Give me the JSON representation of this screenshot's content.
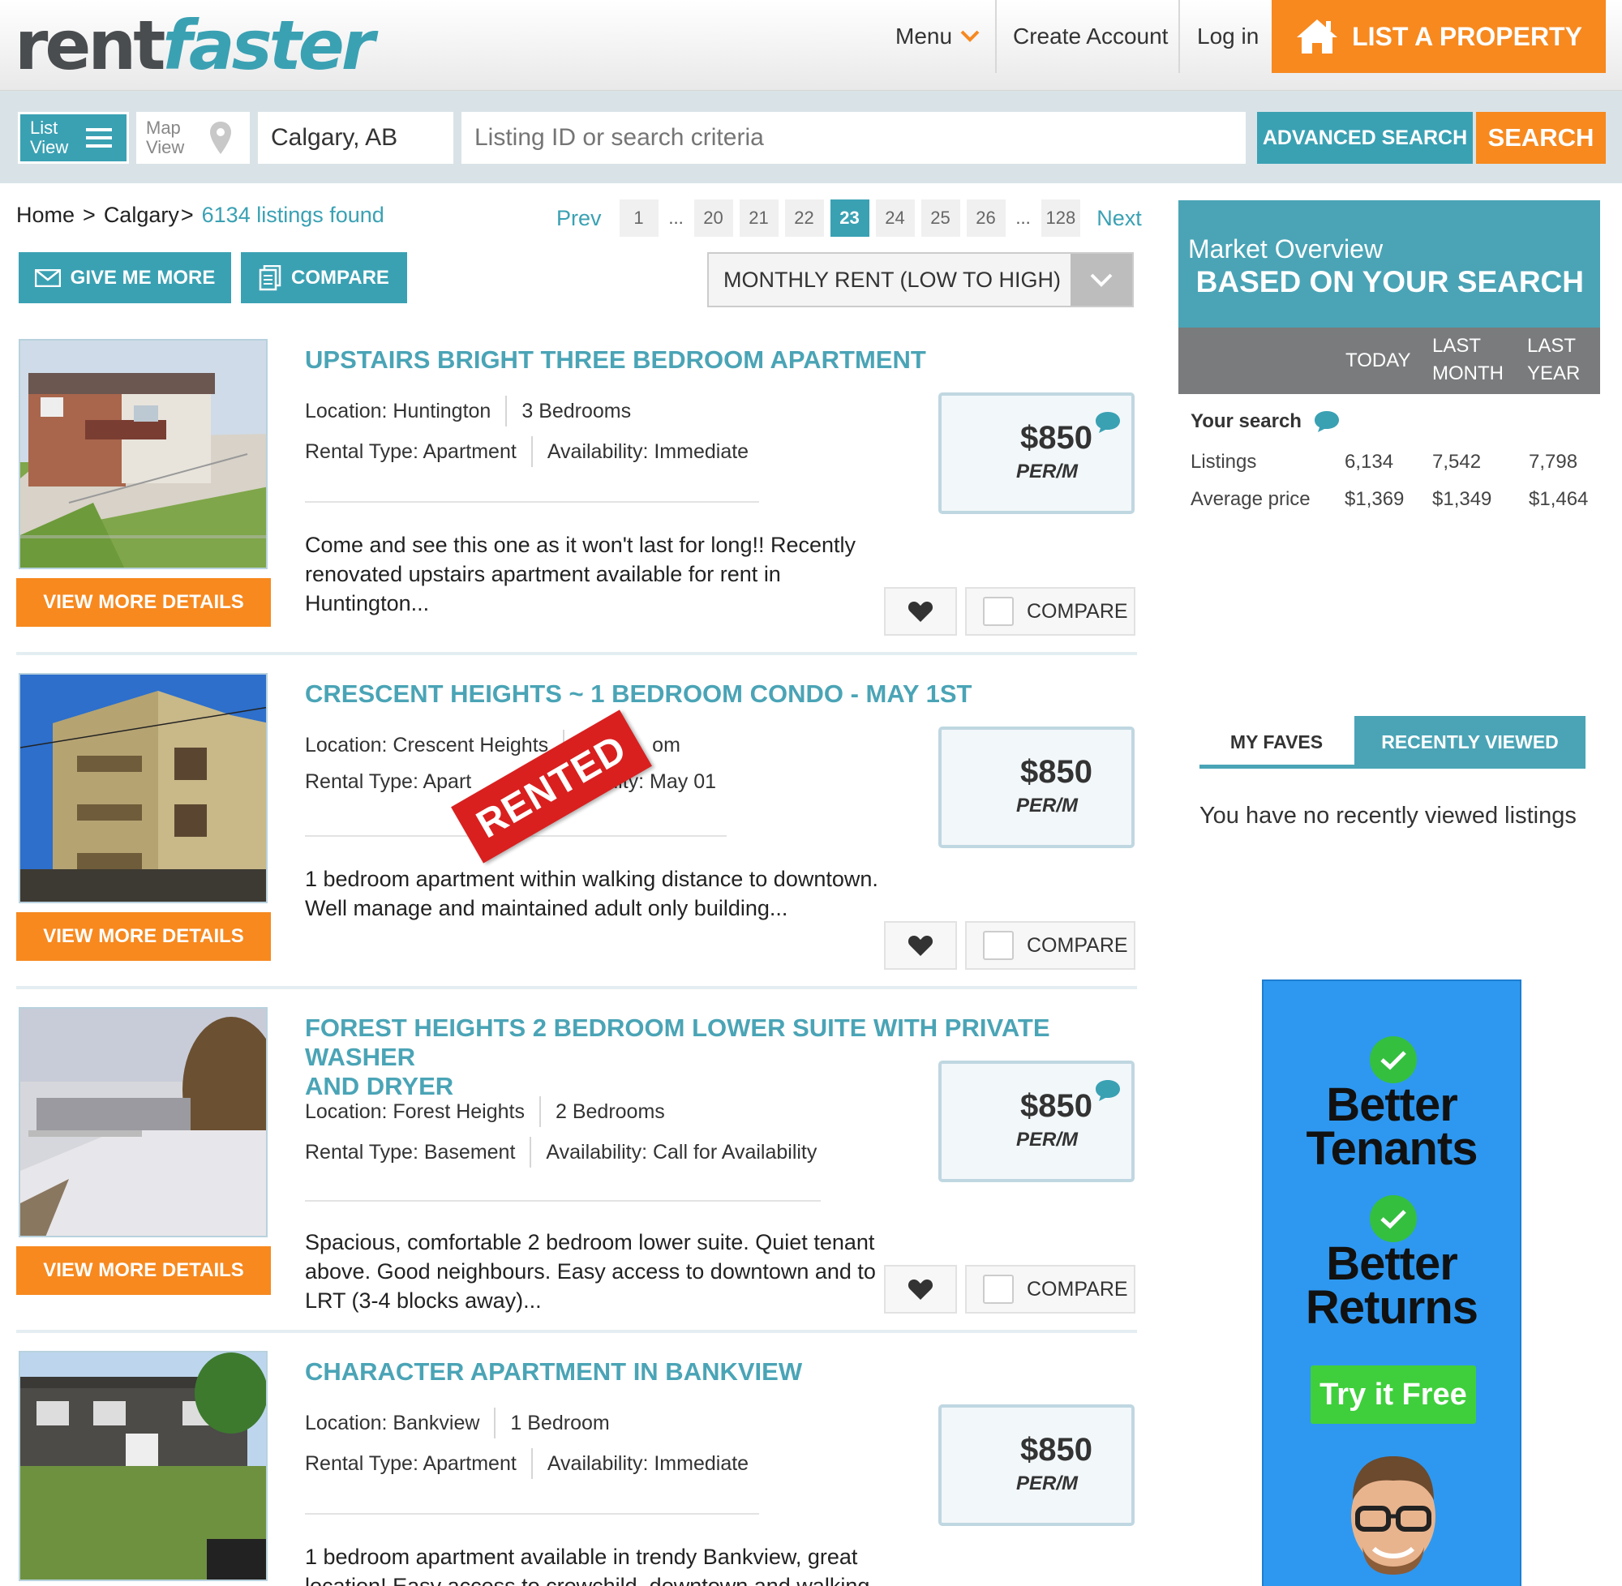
{
  "header": {
    "logo_part1": "rent",
    "logo_part2": "faster",
    "menu_label": "Menu",
    "create_account": "Create Account",
    "login": "Log in",
    "list_property": "LIST A PROPERTY"
  },
  "search": {
    "list_view_line1": "List",
    "list_view_line2": "View",
    "map_view_line1": "Map",
    "map_view_line2": "View",
    "city": "Calgary, AB",
    "criteria_placeholder": "Listing ID or search criteria",
    "advanced": "ADVANCED SEARCH",
    "search_btn": "SEARCH"
  },
  "breadcrumb": {
    "home": "Home",
    "sep1": ">",
    "city": "Calgary",
    "sep2": ">",
    "found": "6134 listings found"
  },
  "pager": {
    "prev": "Prev",
    "next": "Next",
    "pages": [
      "1",
      "...",
      "20",
      "21",
      "22",
      "23",
      "24",
      "25",
      "26",
      "...",
      "128"
    ],
    "active": "23"
  },
  "actions": {
    "give_more": "GIVE ME MORE",
    "compare": "COMPARE",
    "sort": "MONTHLY RENT (LOW TO HIGH)"
  },
  "listings": [
    {
      "title_line1": "UPSTAIRS BRIGHT THREE BEDROOM APARTMENT",
      "title_line2": "",
      "location": "Location: Huntington",
      "bedrooms": "3 Bedrooms",
      "rental_type": "Rental Type: Apartment",
      "availability": "Availability: Immediate",
      "desc_line1": "Come and see this one as it won't last for long!!   Recently",
      "desc_line2": "renovated upstairs apartment available for rent in",
      "desc_line3": "Huntington...",
      "price": "$850",
      "per": "PER/M",
      "details": "VIEW MORE DETAILS",
      "compare": "COMPARE"
    },
    {
      "title_line1": "CRESCENT HEIGHTS ~ 1 BEDROOM CONDO - MAY 1ST",
      "title_line2": "",
      "location": "Location: Crescent Heights",
      "bedrooms": "om",
      "rental_type": "Rental Type: Apart",
      "availability": "ability: May 01",
      "desc_line1": "1 bedroom apartment within walking distance to downtown.",
      "desc_line2": "Well manage and maintained adult only building...",
      "desc_line3": "",
      "price": "$850",
      "per": "PER/M",
      "details": "VIEW MORE DETAILS",
      "compare": "COMPARE",
      "badge": "RENTED"
    },
    {
      "title_line1": "FOREST HEIGHTS 2 BEDROOM LOWER SUITE WITH PRIVATE WASHER",
      "title_line2": "AND DRYER",
      "location": "Location: Forest Heights",
      "bedrooms": "2 Bedrooms",
      "rental_type": "Rental Type: Basement",
      "availability": "Availability: Call for Availability",
      "desc_line1": "Spacious, comfortable 2 bedroom lower suite.   Quiet tenant",
      "desc_line2": "above. Good neighbours.    Easy access to downtown and to",
      "desc_line3": "LRT (3-4 blocks away)...",
      "price": "$850",
      "per": "PER/M",
      "details": "VIEW MORE DETAILS",
      "compare": "COMPARE"
    },
    {
      "title_line1": "CHARACTER APARTMENT IN BANKVIEW",
      "title_line2": "",
      "location": "Location: Bankview",
      "bedrooms": "1 Bedroom",
      "rental_type": "Rental Type: Apartment",
      "availability": "Availability: Immediate",
      "desc_line1": "1 bedroom apartment available in trendy Bankview, great",
      "desc_line2": "location! Easy access to crowchild, downtown and walking",
      "desc_line3": "",
      "price": "$850",
      "per": "PER/M"
    }
  ],
  "market": {
    "title1": "Market Overview",
    "title2": "BASED ON YOUR SEARCH",
    "col_today": "TODAY",
    "col_month_1": "LAST",
    "col_month_2": "MONTH",
    "col_year_1": "LAST",
    "col_year_2": "YEAR",
    "your_search": "Your search",
    "rows": [
      {
        "label": "Listings",
        "today": "6,134",
        "month": "7,542",
        "year": "7,798"
      },
      {
        "label": "Average price",
        "today": "$1,369",
        "month": "$1,349",
        "year": "$1,464"
      }
    ]
  },
  "tabs": {
    "faves": "MY FAVES",
    "recent": "RECENTLY VIEWED",
    "empty": "You have no recently viewed listings"
  },
  "ad": {
    "line1": "Better",
    "line2": "Tenants",
    "line3": "Better",
    "line4": "Returns",
    "cta": "Try it Free"
  },
  "colors": {
    "brand_teal": "#3aa1b3",
    "brand_orange": "#f7891f",
    "rented_red": "#d9201f"
  }
}
